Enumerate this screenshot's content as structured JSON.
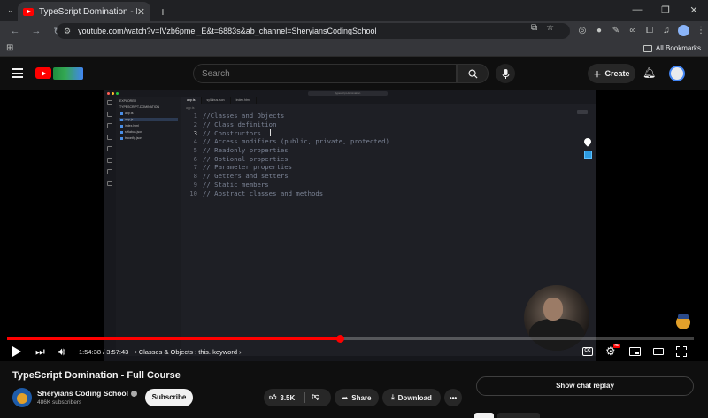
{
  "browser": {
    "tab_title": "TypeScript Domination - Full Co",
    "tab_close": "✕",
    "new_tab": "+",
    "win_min": "—",
    "win_max": "❐",
    "win_close": "✕",
    "url": "youtube.com/watch?v=lVzb6pmel_E&t=6883s&ab_channel=SheryiansCodingSchool",
    "bookmarks_label": "All Bookmarks"
  },
  "youtube": {
    "search_placeholder": "Search",
    "create_label": "Create"
  },
  "editor": {
    "explorer_title": "EXPLORER",
    "project": "TYPESCRIPT-DOMINATION",
    "files": [
      "app.ts",
      "app.js",
      "index.html",
      "syllabus.json",
      "tsconfig.json"
    ],
    "tabs": [
      "app.ts",
      "syllabus.json",
      "index.html"
    ],
    "command_center": "typescript-domination",
    "breadcrumb": "app.ts",
    "lines": [
      {
        "n": "1",
        "t": "//Classes and Objects"
      },
      {
        "n": "2",
        "t": "// Class definition"
      },
      {
        "n": "3",
        "t": "// Constructors"
      },
      {
        "n": "4",
        "t": "// Access modifiers (public, private, protected)"
      },
      {
        "n": "5",
        "t": "// Readonly properties"
      },
      {
        "n": "6",
        "t": "// Optional properties"
      },
      {
        "n": "7",
        "t": "// Parameter properties"
      },
      {
        "n": "8",
        "t": "// Getters and setters"
      },
      {
        "n": "9",
        "t": "// Static members"
      },
      {
        "n": "10",
        "t": "// Abstract classes and methods"
      }
    ]
  },
  "player": {
    "progress_fraction": 0.485,
    "time": "1:54:38 / 3:57:43",
    "chapter": "• Classes & Objects : this. keyword",
    "chapter_arrow": "›",
    "cc_label": "CC",
    "hd_badge": "HD"
  },
  "video": {
    "title": "TypeScript Domination - Full Course",
    "channel": "Sheryians Coding School",
    "subscribers": "486K subscribers",
    "subscribe_label": "Subscribe",
    "likes": "3.5K",
    "share_label": "Share",
    "download_label": "Download",
    "more_label": "•••",
    "chat_replay_label": "Show chat replay"
  },
  "colors": {
    "accent": "#ff0000",
    "background": "#0f0f0f"
  }
}
